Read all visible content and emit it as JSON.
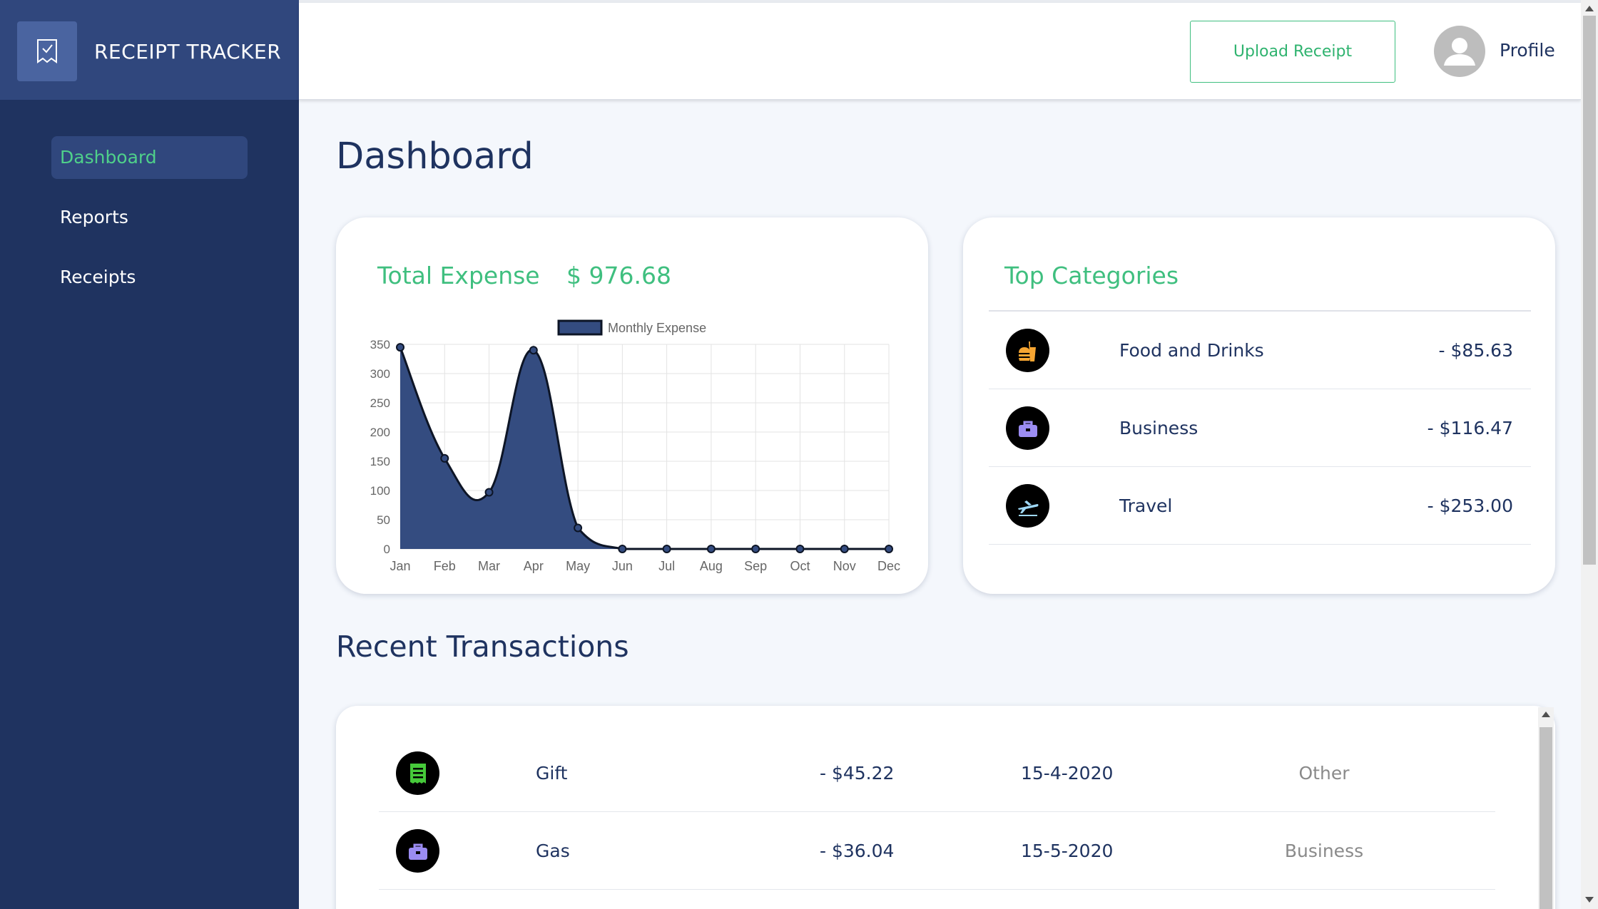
{
  "app": {
    "title": "RECEIPT TRACKER",
    "logo_icon": "receipt-check-icon"
  },
  "sidebar": {
    "items": [
      {
        "label": "Dashboard",
        "active": true
      },
      {
        "label": "Reports",
        "active": false
      },
      {
        "label": "Receipts",
        "active": false
      }
    ]
  },
  "header": {
    "upload_label": "Upload Receipt",
    "profile_label": "Profile",
    "avatar_icon": "user-icon"
  },
  "page": {
    "title": "Dashboard"
  },
  "expense": {
    "label": "Total Expense",
    "value": "$ 976.68"
  },
  "chart_data": {
    "type": "area",
    "categories": [
      "Jan",
      "Feb",
      "Mar",
      "Apr",
      "May",
      "Jun",
      "Jul",
      "Aug",
      "Sep",
      "Oct",
      "Nov",
      "Dec"
    ],
    "series": [
      {
        "name": "Monthly Expense",
        "values": [
          345,
          155,
          97,
          340,
          36,
          0,
          0,
          0,
          0,
          0,
          0,
          0
        ]
      }
    ],
    "ylim": [
      0,
      350
    ],
    "yticks": [
      0,
      50,
      100,
      150,
      200,
      250,
      300,
      350
    ],
    "grid": true,
    "legend": "top",
    "colors": {
      "fill": "#344c80",
      "line": "#0d1526"
    }
  },
  "categories_card": {
    "title": "Top Categories",
    "items": [
      {
        "name": "Food and Drinks",
        "amount": "- $85.63",
        "icon": "food-drink-icon"
      },
      {
        "name": "Business",
        "amount": "- $116.47",
        "icon": "briefcase-icon"
      },
      {
        "name": "Travel",
        "amount": "- $253.00",
        "icon": "airplane-icon"
      }
    ]
  },
  "transactions": {
    "title": "Recent Transactions",
    "rows": [
      {
        "name": "Gift",
        "amount": "- $45.22",
        "date": "15-4-2020",
        "category": "Other",
        "icon": "receipt-icon"
      },
      {
        "name": "Gas",
        "amount": "- $36.04",
        "date": "15-5-2020",
        "category": "Business",
        "icon": "briefcase-icon"
      }
    ]
  },
  "colors": {
    "sidebar": "#1f3360",
    "brand": "#30477d",
    "accent": "#3fbf7f",
    "text": "#1f3360"
  }
}
